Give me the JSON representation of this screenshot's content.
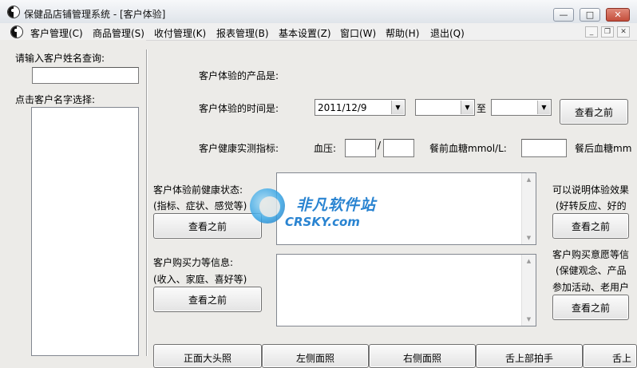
{
  "window": {
    "title": "保健品店铺管理系统 - [客户体验]",
    "controls": {
      "minimize": "—",
      "maximize": "□",
      "close": "✕"
    }
  },
  "menu": {
    "items": [
      "客户管理(C)",
      "商品管理(S)",
      "收付管理(K)",
      "报表管理(B)",
      "基本设置(Z)",
      "窗口(W)",
      "帮助(H)",
      "退出(Q)"
    ],
    "mdi_controls": {
      "minimize": "_",
      "restore": "❐",
      "close": "✕"
    }
  },
  "left_panel": {
    "search_label": "请输入客户姓名查询:",
    "search_value": "",
    "select_label": "点击客户名字选择:"
  },
  "form": {
    "product_label": "客户体验的产品是:",
    "time_label": "客户体验的时间是:",
    "date_value": "2011/12/9",
    "combo2_value": "",
    "to_label": "至",
    "combo3_value": "",
    "view_prev_top": "查看之前",
    "health_label": "客户健康实测指标:",
    "blood_pressure_label": "血压:",
    "bp_high": "",
    "bp_sep": "/",
    "bp_low": "",
    "pre_meal_label": "餐前血糖mmol/L:",
    "pre_meal_value": "",
    "post_meal_label": "餐后血糖mm",
    "pre_health_label": "客户体验前健康状态:",
    "pre_health_hint": "(指标、症状、感觉等)",
    "pre_health_btn": "查看之前",
    "effect_label": "可以说明体验效果",
    "effect_hint": "(好转反应、好的",
    "effect_btn": "查看之前",
    "purchase_power_label": "客户购买力等信息:",
    "purchase_power_hint": "(收入、家庭、喜好等)",
    "purchase_power_btn": "查看之前",
    "intent_label": "客户购买意愿等信",
    "intent_hint1": "(保健观念、产品",
    "intent_hint2": "参加活动、老用户",
    "intent_btn": "查看之前",
    "bottom_buttons": [
      "正面大头照",
      "左侧面照",
      "右侧面照",
      "舌上部拍手",
      "舌上"
    ]
  },
  "watermark": {
    "cn": "非凡软件站",
    "en": "CRSKY.com"
  },
  "colors": {
    "window_bg": "#ecebe8",
    "close_red": "#c44e3c",
    "watermark_blue": "#2a84d1"
  },
  "icons": [
    "app-yin-yang-icon",
    "combo-arrow-icon",
    "scroll-up-icon",
    "scroll-down-icon"
  ]
}
